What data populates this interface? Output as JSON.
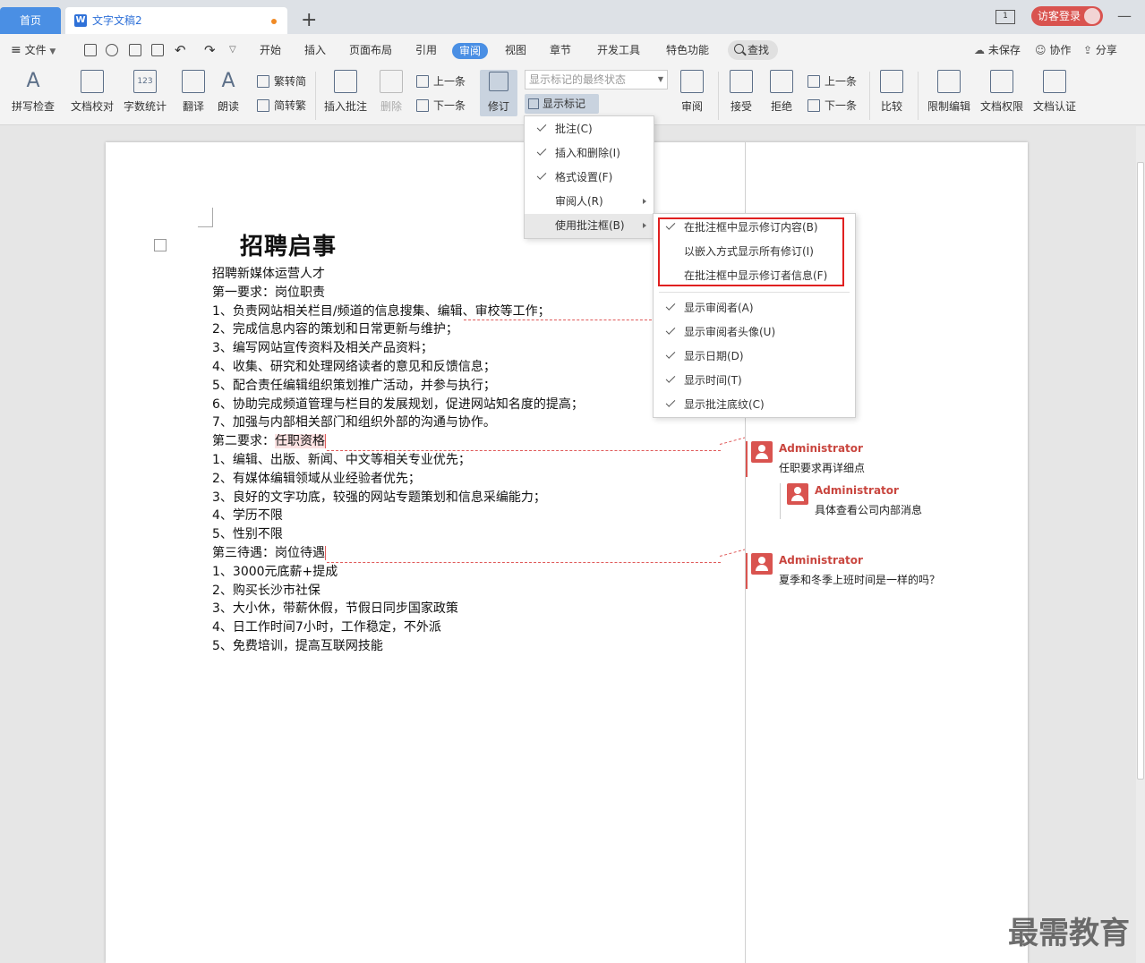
{
  "titlebar": {
    "home_tab": "首页",
    "doc_tab": "文字文稿2",
    "new_tab": "+",
    "monitor_label": "1",
    "login_label": "访客登录",
    "minimize": "—"
  },
  "menubar": {
    "file": "文件",
    "items": [
      "开始",
      "插入",
      "页面布局",
      "引用",
      "审阅",
      "视图",
      "章节",
      "开发工具",
      "特色功能"
    ],
    "active": "审阅",
    "search": "查找",
    "right": {
      "unsaved": "未保存",
      "collab": "协作",
      "share": "分享"
    }
  },
  "ribbon": {
    "spell": "拼写检查",
    "proof": "文档校对",
    "wordcount": "字数统计",
    "translate": "翻译",
    "read": "朗读",
    "trad": "繁转简",
    "simp": "简转繁",
    "insert_comment": "插入批注",
    "delete": "删除",
    "prev": "上一条",
    "next": "下一条",
    "track": "修订",
    "state_placeholder": "显示标记的最终状态",
    "show_markup": "显示标记",
    "review": "审阅",
    "accept": "接受",
    "reject": "拒绝",
    "prev2": "上一条",
    "next2": "下一条",
    "compare": "比较",
    "restrict": "限制编辑",
    "doc_perm": "文档权限",
    "doc_cert": "文档认证"
  },
  "document": {
    "title": "招聘启事",
    "lines": [
      "招聘新媒体运营人才",
      "第一要求：岗位职责",
      "1、负责网站相关栏目/频道的信息搜集、编辑、审校等工作；",
      "2、完成信息内容的策划和日常更新与维护；",
      "3、编写网站宣传资料及相关产品资料；",
      "4、收集、研究和处理网络读者的意见和反馈信息；",
      "5、配合责任编辑组织策划推广活动，并参与执行；",
      "6、协助完成频道管理与栏目的发展规划，促进网站知名度的提高；",
      "7、加强与内部相关部门和组织外部的沟通与协作。",
      "第二要求：",
      "1、编辑、出版、新闻、中文等相关专业优先；",
      "2、有媒体编辑领域从业经验者优先；",
      "3、良好的文字功底，较强的网站专题策划和信息采编能力；",
      "4、学历不限",
      "5、性别不限",
      "第三待遇：岗位待遇",
      "1、3000元底薪+提成",
      "2、购买长沙市社保",
      "3、大小休，带薪休假，节假日同步国家政策",
      "4、日工作时间7小时，工作稳定，不外派",
      "5、免费培训，提高互联网技能"
    ],
    "marked": "任职资格"
  },
  "comments": [
    {
      "author": "Administrator",
      "text": "任职要求再详细点"
    },
    {
      "author": "Administrator",
      "text": "具体查看公司内部消息"
    },
    {
      "author": "Administrator",
      "text": "夏季和冬季上班时间是一样的吗？"
    }
  ],
  "menu1": [
    {
      "label": "批注(C)",
      "checked": true
    },
    {
      "label": "插入和删除(I)",
      "checked": true
    },
    {
      "label": "格式设置(F)",
      "checked": true
    },
    {
      "label": "审阅人(R)",
      "checked": false
    },
    {
      "label": "使用批注框(B)",
      "checked": false
    }
  ],
  "menu2": [
    {
      "label": "在批注框中显示修订内容(B)",
      "checked": true
    },
    {
      "label": "以嵌入方式显示所有修订(I)",
      "checked": false
    },
    {
      "label": "在批注框中显示修订者信息(F)",
      "checked": false
    },
    {
      "label": "显示审阅者(A)",
      "checked": true
    },
    {
      "label": "显示审阅者头像(U)",
      "checked": true
    },
    {
      "label": "显示日期(D)",
      "checked": true
    },
    {
      "label": "显示时间(T)",
      "checked": true
    },
    {
      "label": "显示批注底纹(C)",
      "checked": true
    }
  ],
  "watermark": "最需教育",
  "colors": {
    "accent": "#4a8fe4",
    "comment_red": "#d9534f",
    "highlight_box": "#e02020"
  }
}
